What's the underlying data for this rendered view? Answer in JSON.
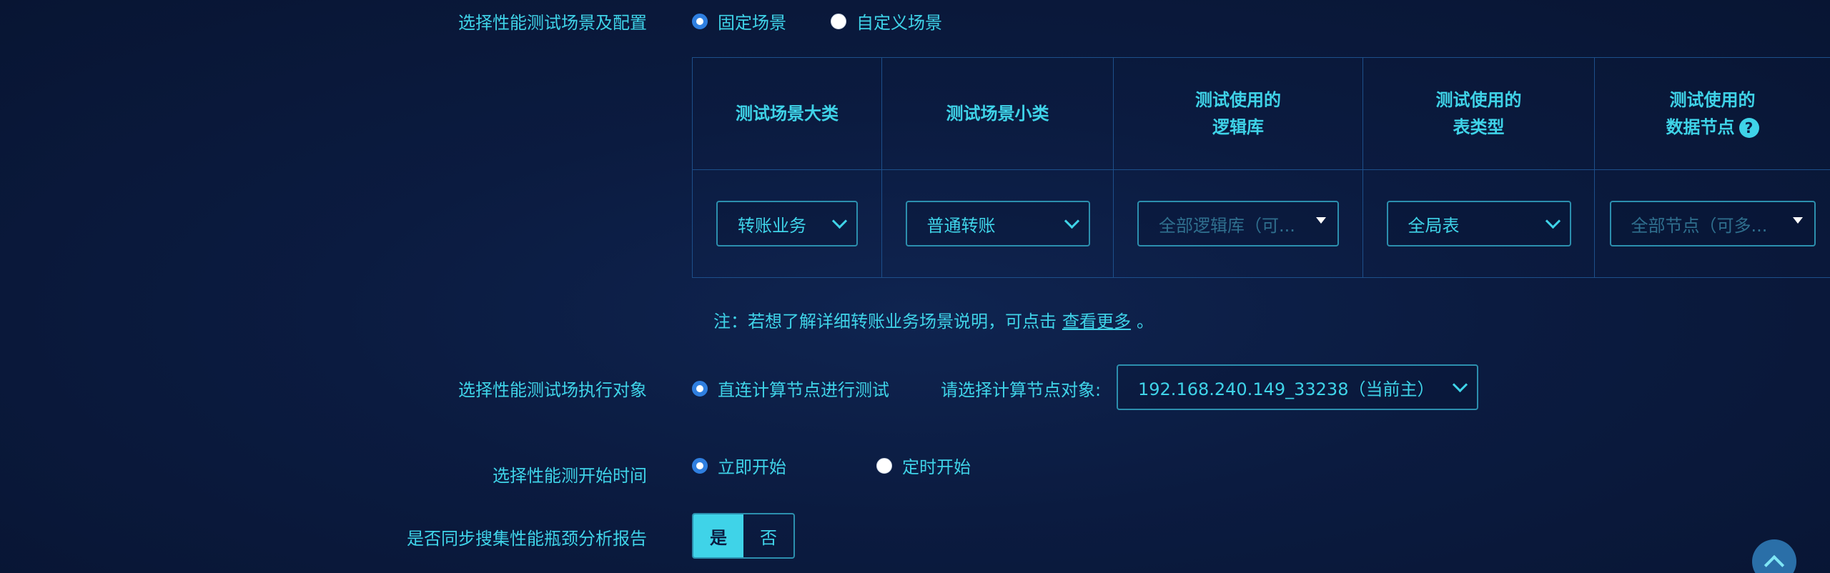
{
  "scenario_row": {
    "label": "选择性能测试场景及配置",
    "options": [
      "固定场景",
      "自定义场景"
    ],
    "selected": "固定场景"
  },
  "table": {
    "headers": {
      "category": "测试场景大类",
      "subcategory": "测试场景小类",
      "logic_db_line1": "测试使用的",
      "logic_db_line2": "逻辑库",
      "table_type_line1": "测试使用的",
      "table_type_line2": "表类型",
      "data_node_line1": "测试使用的",
      "data_node_line2": "数据节点"
    },
    "values": {
      "category": "转账业务",
      "subcategory": "普通转账",
      "logic_db_placeholder": "全部逻辑库（可...",
      "table_type": "全局表",
      "data_node_placeholder": "全部节点（可多..."
    }
  },
  "note": {
    "prefix": "注：若想了解详细转账业务场景说明，可点击",
    "link": "查看更多",
    "suffix": "。"
  },
  "target_row": {
    "label": "选择性能测试场执行对象",
    "option": "直连计算节点进行测试",
    "node_label": "请选择计算节点对象:",
    "node_value": "192.168.240.149_33238（当前主）"
  },
  "start_row": {
    "label": "选择性能测开始时间",
    "options": [
      "立即开始",
      "定时开始"
    ],
    "selected": "立即开始"
  },
  "report_row": {
    "label": "是否同步搜集性能瓶颈分析报告",
    "yes": "是",
    "no": "否",
    "selected": "是"
  },
  "colors": {
    "accent": "#3fd3e8",
    "radio_checked": "#2f7fe0",
    "border": "#2c8fae",
    "background": "#0b1b40"
  }
}
